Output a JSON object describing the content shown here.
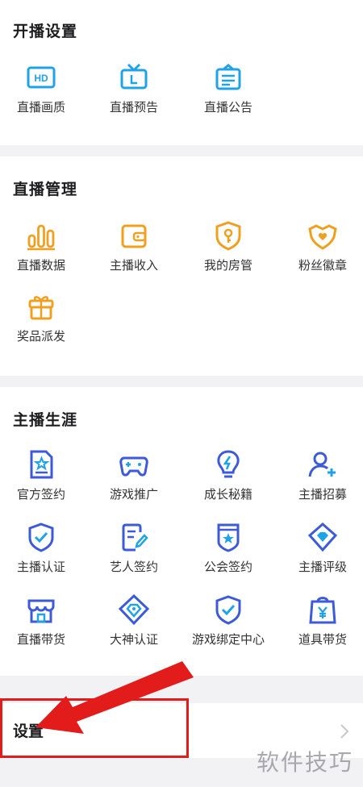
{
  "sections": [
    {
      "title": "开播设置",
      "items": [
        {
          "label": "直播画质",
          "icon": "hd-icon"
        },
        {
          "label": "直播预告",
          "icon": "tv-icon"
        },
        {
          "label": "直播公告",
          "icon": "notice-icon"
        }
      ]
    },
    {
      "title": "直播管理",
      "items": [
        {
          "label": "直播数据",
          "icon": "bar-chart-icon"
        },
        {
          "label": "主播收入",
          "icon": "wallet-icon"
        },
        {
          "label": "我的房管",
          "icon": "shield-key-icon"
        },
        {
          "label": "粉丝徽章",
          "icon": "heart-badge-icon"
        },
        {
          "label": "奖品派发",
          "icon": "gift-icon"
        }
      ]
    },
    {
      "title": "主播生涯",
      "items": [
        {
          "label": "官方签约",
          "icon": "certificate-icon"
        },
        {
          "label": "游戏推广",
          "icon": "gamepad-icon"
        },
        {
          "label": "成长秘籍",
          "icon": "lightbulb-icon"
        },
        {
          "label": "主播招募",
          "icon": "add-user-icon"
        },
        {
          "label": "主播认证",
          "icon": "shield-check-icon"
        },
        {
          "label": "艺人签约",
          "icon": "edit-document-icon"
        },
        {
          "label": "公会签约",
          "icon": "guild-star-icon"
        },
        {
          "label": "主播评级",
          "icon": "diamond-badge-icon"
        },
        {
          "label": "直播带货",
          "icon": "shop-icon"
        },
        {
          "label": "大神认证",
          "icon": "god-diamond-icon"
        },
        {
          "label": "游戏绑定中心",
          "icon": "shield-bind-icon"
        },
        {
          "label": "道具带货",
          "icon": "shopping-bag-icon"
        }
      ]
    }
  ],
  "settings": {
    "label": "设置"
  },
  "watermark": "软件技巧",
  "colors": {
    "blue_accent": "#1fa3e6",
    "orange_accent": "#f0a020",
    "indigo_accent": "#3d5bd6",
    "annotation_red": "#e21b1b"
  }
}
